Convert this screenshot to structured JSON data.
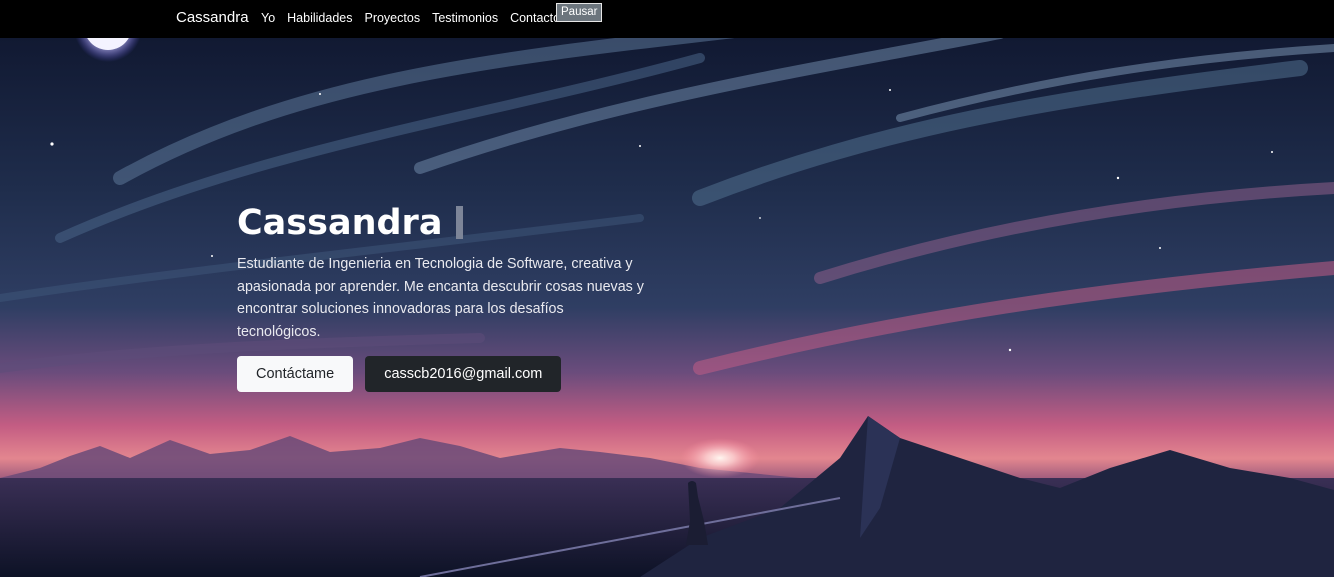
{
  "navbar": {
    "brand": "Cassandra",
    "links": [
      "Yo",
      "Habilidades",
      "Proyectos",
      "Testimonios",
      "Contacto"
    ],
    "pause_label": "Pausar"
  },
  "hero": {
    "title": "Cassandra",
    "description": "Estudiante de Ingenieria en Tecnologia de Software, creativa y apasionada por aprender. Me encanta descubrir cosas nuevas y encontrar soluciones innovadoras para los desafíos tecnológicos.",
    "contact_button": "Contáctame",
    "email_button": "casscb2016@gmail.com"
  },
  "colors": {
    "navbar_bg": "#000000",
    "sky_top": "#121a33",
    "sky_mid": "#2b3a5c",
    "horizon_pink": "#d56a86",
    "button_light": "#f8f9fa",
    "button_dark": "#212529"
  }
}
